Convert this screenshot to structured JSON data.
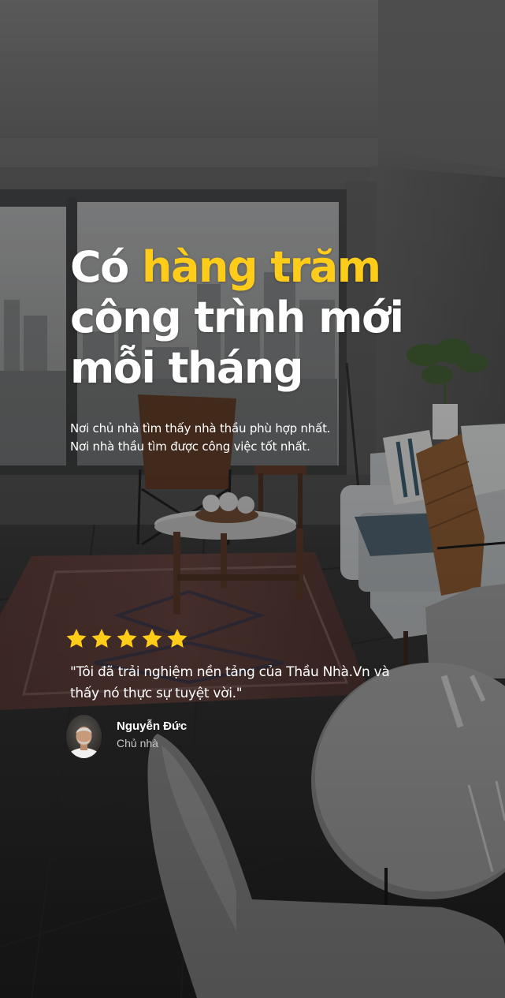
{
  "hero": {
    "headline_line1_prefix": "Có",
    "headline_line1_highlight": "hàng trăm",
    "headline_line2": "công trình mới",
    "headline_line3": "mỗi tháng",
    "subtitle_line1": "Nơi chủ nhà tìm thấy nhà thầu phù hợp nhất.",
    "subtitle_line2": "Nơi nhà thầu tìm được công việc tốt nhất."
  },
  "testimonial": {
    "rating": 5,
    "rating_max": 5,
    "quote_line1": "\"Tôi đã trải nghiệm nền tảng của Thầu Nhà.Vn và",
    "quote_line2": "thấy nó thực sự tuyệt vời.\"",
    "author_name": "Nguyễn Đức",
    "author_role": "Chủ nhà"
  },
  "colors": {
    "accent": "#ffcc1a",
    "star": "#ffcc1a",
    "text": "#ffffff",
    "muted_text": "#c8c8c8"
  },
  "icons": {
    "rating": "star-icon",
    "avatar": "user-avatar"
  }
}
